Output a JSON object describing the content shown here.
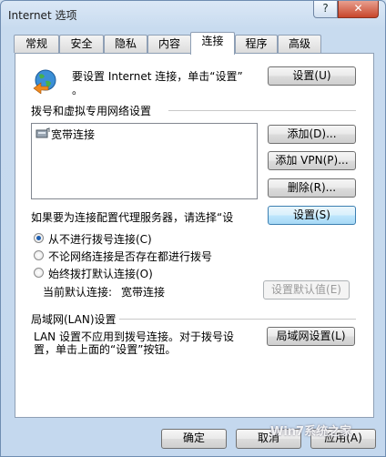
{
  "window": {
    "title": "Internet 选项",
    "help": "?",
    "close": "✕"
  },
  "tabs": [
    "常规",
    "安全",
    "隐私",
    "内容",
    "连接",
    "程序",
    "高级"
  ],
  "setup": {
    "text_line1": "要设置 Internet 连接，单击“设置”",
    "text_line2": "。",
    "button": "设置(U)"
  },
  "dialup": {
    "heading": "拨号和虚拟专用网络设置",
    "connections": [
      "宽带连接"
    ],
    "add_button": "添加(D)...",
    "add_vpn_button": "添加 VPN(P)...",
    "remove_button": "删除(R)...",
    "proxy_text": "如果要为连接配置代理服务器，请选择“设",
    "settings_button": "设置(S)",
    "radio_never": "从不进行拨号连接(C)",
    "radio_whenever": "不论网络连接是否存在都进行拨号",
    "radio_always": "始终拨打默认连接(O)",
    "current_default_label": "当前默认连接:",
    "current_default_value": "宽带连接",
    "set_default_button": "设置默认值(E)"
  },
  "lan": {
    "heading": "局域网(LAN)设置",
    "text_line1": "LAN 设置不应用到拨号连接。对于拨号设",
    "text_line2": "置，单击上面的“设置”按钮。",
    "button": "局域网设置(L)"
  },
  "footer": {
    "ok": "确定",
    "cancel": "取消",
    "apply": "应用(A)"
  },
  "watermark": "Win7系统之家"
}
